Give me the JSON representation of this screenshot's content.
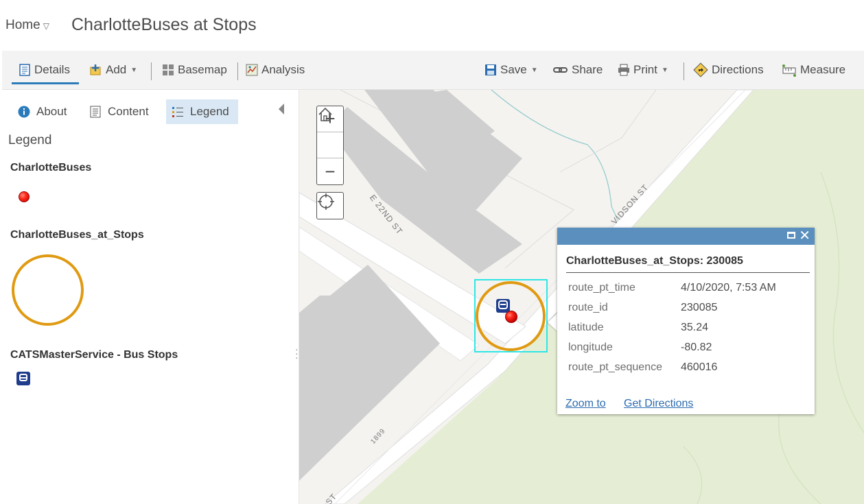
{
  "header": {
    "home_label": "Home",
    "caret": "▽",
    "title": "CharlotteBuses at Stops"
  },
  "toolbar": {
    "details": "Details",
    "add": "Add",
    "basemap": "Basemap",
    "analysis": "Analysis",
    "save": "Save",
    "share": "Share",
    "print": "Print",
    "directions": "Directions",
    "measure": "Measure",
    "dropdown_glyph": "▼"
  },
  "panel": {
    "tabs": {
      "about": "About",
      "content": "Content",
      "legend": "Legend"
    },
    "legend_heading": "Legend",
    "layers": [
      {
        "title": "CharlotteBuses"
      },
      {
        "title": "CharlotteBuses_at_Stops"
      },
      {
        "title": "CATSMasterService - Bus Stops"
      }
    ]
  },
  "map": {
    "zoom_in": "+",
    "zoom_out": "−",
    "streets": {
      "e22nd": "E 22ND ST",
      "davidson": "VIDSON ST",
      "address": "1899",
      "bottom": "ST"
    },
    "colors": {
      "building": "#cfcfcf",
      "road": "#ffffff",
      "park": "#e5eed4",
      "selection": "#2ee6e6",
      "ring": "#e09a12",
      "water": "#8fc9c9"
    }
  },
  "popup": {
    "title": "CharlotteBuses_at_Stops: 230085",
    "close_glyph": "✕",
    "attributes": [
      {
        "key": "route_pt_time",
        "value": "4/10/2020, 7:53 AM"
      },
      {
        "key": "route_id",
        "value": "230085"
      },
      {
        "key": "latitude",
        "value": "35.24"
      },
      {
        "key": "longitude",
        "value": "-80.82"
      },
      {
        "key": "route_pt_sequence",
        "value": "460016"
      }
    ],
    "zoom_to": "Zoom to",
    "get_directions": "Get Directions"
  }
}
